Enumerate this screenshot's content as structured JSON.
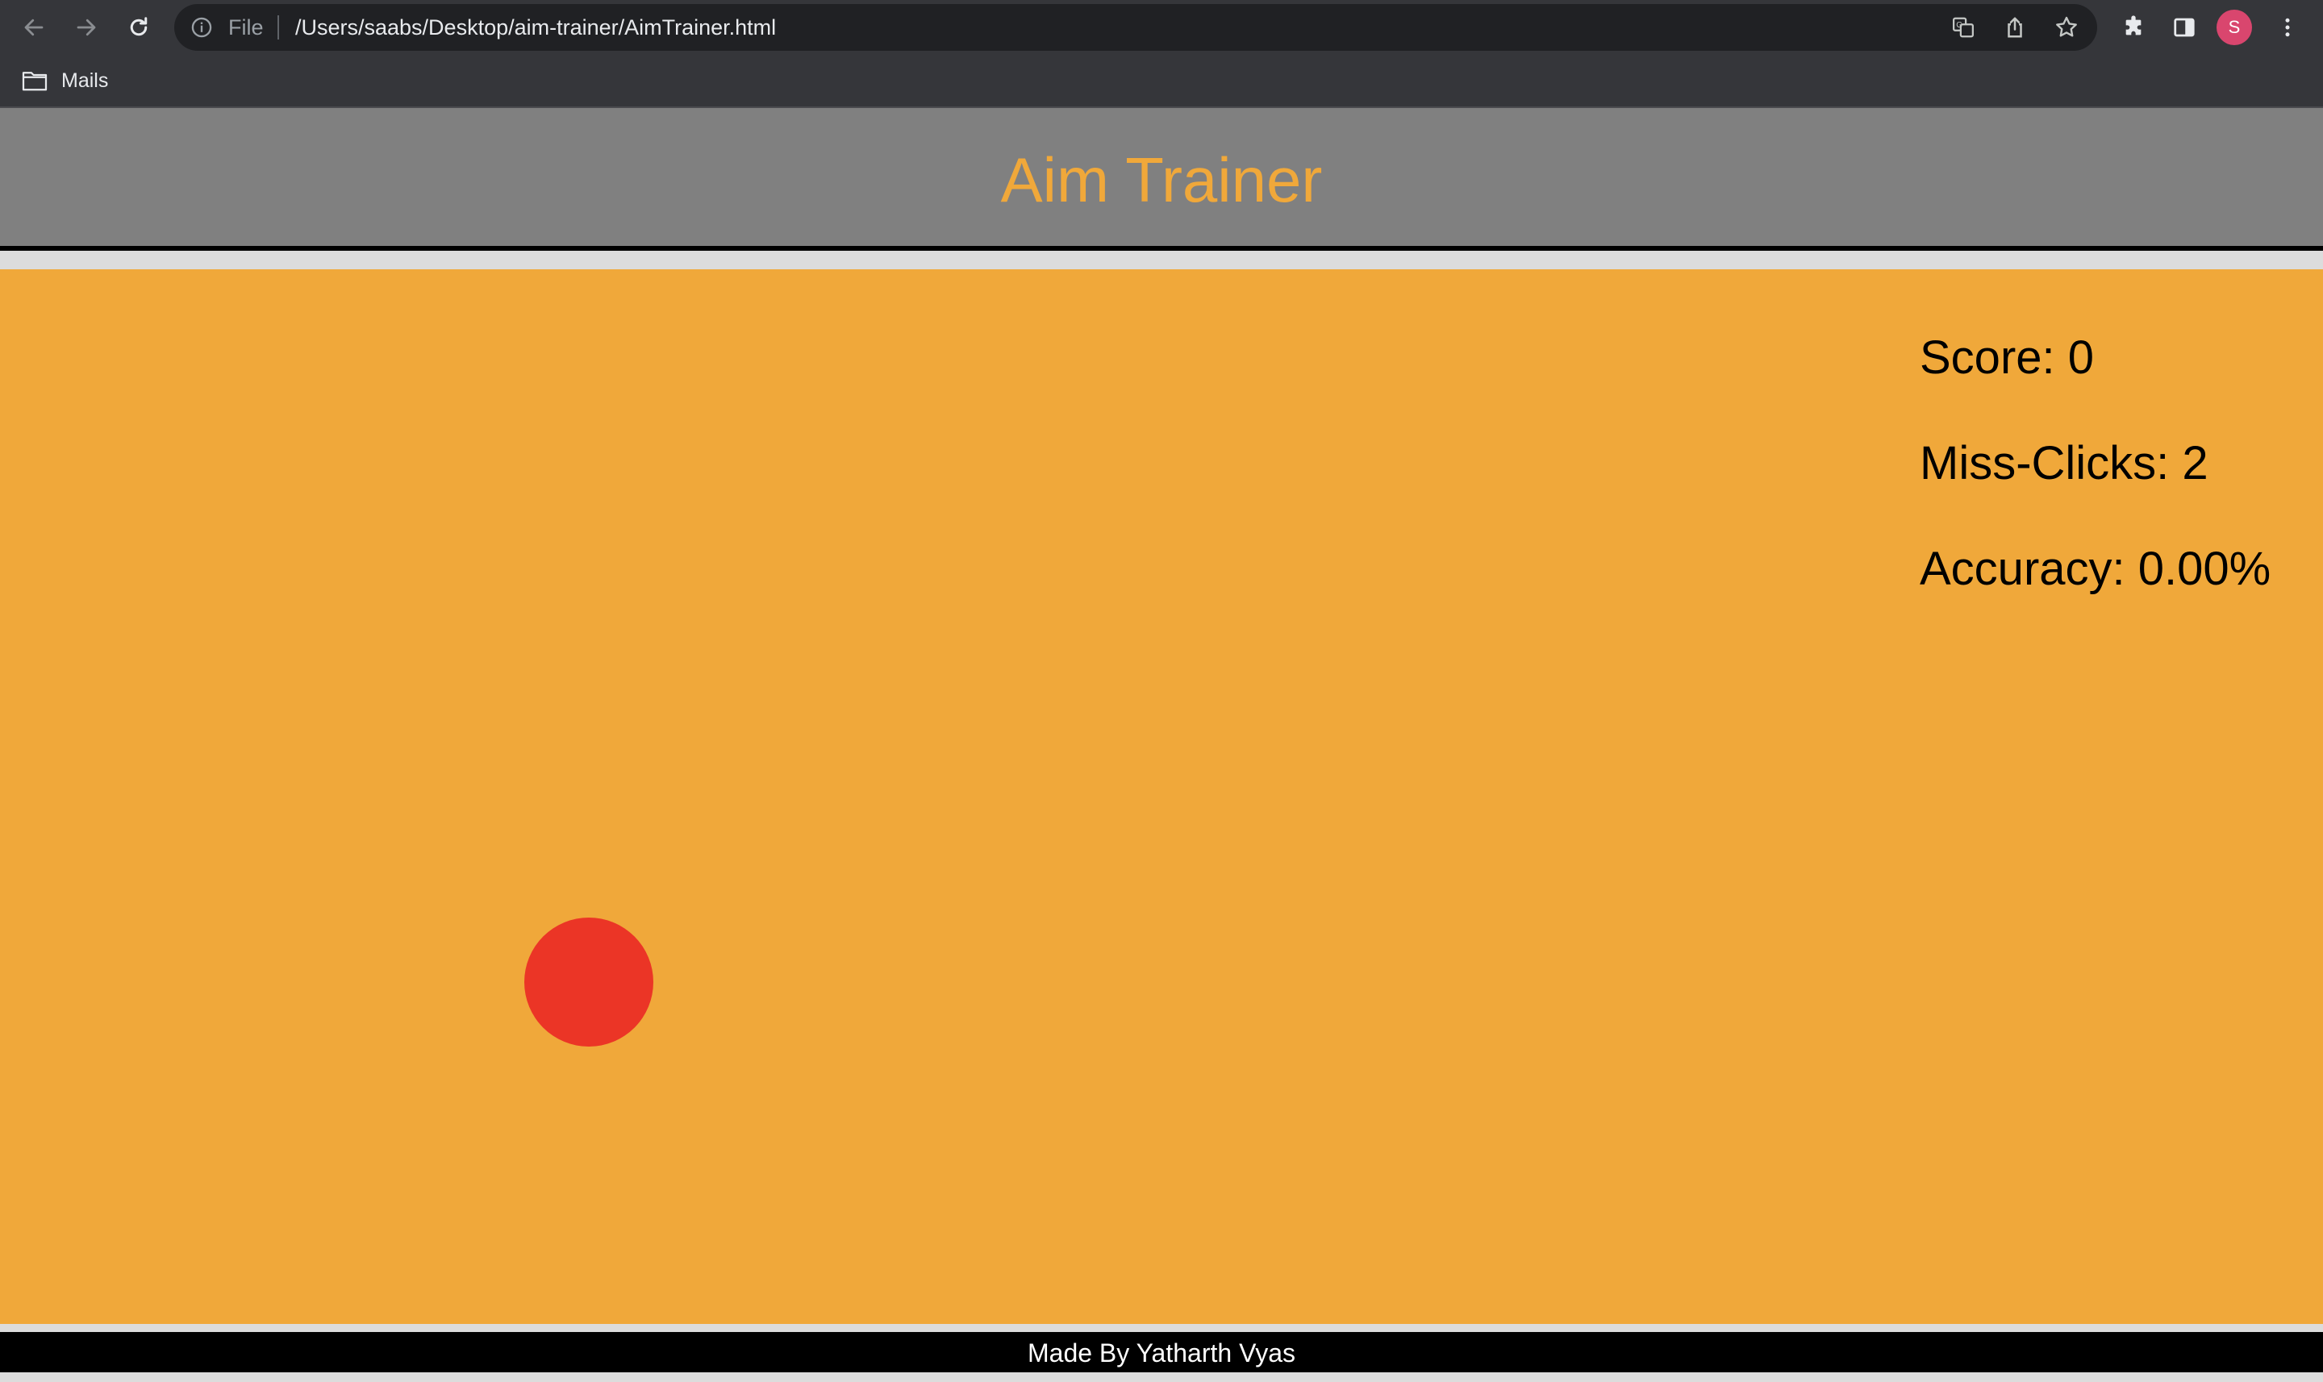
{
  "browser": {
    "file_label": "File",
    "url": "/Users/saabs/Desktop/aim-trainer/AimTrainer.html",
    "profile_initial": "S",
    "icons": [
      "back-icon",
      "forward-icon",
      "reload-icon",
      "info-icon",
      "translate-icon",
      "share-icon",
      "bookmark-star-icon",
      "extensions-icon",
      "side-panel-icon",
      "menu-icon"
    ],
    "bookmarks": [
      {
        "label": "Mails",
        "icon": "folder-icon"
      }
    ]
  },
  "page": {
    "title": "Aim Trainer",
    "stats": {
      "score": "Score: 0",
      "miss_clicks": "Miss-Clicks: 2",
      "accuracy": "Accuracy: 0.00%"
    },
    "footer": "Made By Yatharth Vyas"
  },
  "colors": {
    "header_bg": "#808080",
    "accent": "#f0a83a",
    "target": "#eb3526",
    "footer_bg": "#000000"
  }
}
